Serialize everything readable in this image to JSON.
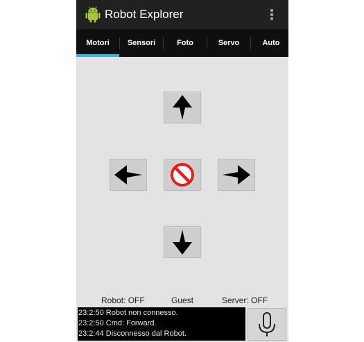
{
  "app": {
    "title": "Robot Explorer",
    "icon": "android-icon",
    "menu_icon": "overflow-menu-icon"
  },
  "tabs": [
    {
      "label": "Motori",
      "selected": true
    },
    {
      "label": "Sensori",
      "selected": false
    },
    {
      "label": "Foto",
      "selected": false
    },
    {
      "label": "Servo",
      "selected": false
    },
    {
      "label": "Auto",
      "selected": false
    }
  ],
  "controls": {
    "up": {
      "icon": "arrow-up-icon"
    },
    "left": {
      "icon": "arrow-left-icon"
    },
    "stop": {
      "icon": "stop-icon"
    },
    "right": {
      "icon": "arrow-right-icon"
    },
    "down": {
      "icon": "arrow-down-icon"
    }
  },
  "status": {
    "robot": "Robot: OFF",
    "user": "Guest",
    "server": "Server: OFF"
  },
  "log": [
    "23:2:50 Robot non connesso.",
    "23:2:50 Cmd: Forward.",
    "23:2:44 Disconnesso dal Robot."
  ],
  "mic": {
    "icon": "microphone-icon"
  },
  "colors": {
    "actionbar": "#212121",
    "tabbar": "#0f0f0f",
    "tab_indicator": "#33b5e5",
    "content_bg": "#e3e3e3",
    "stop_red": "#e02020",
    "android_green": "#a4c639"
  }
}
